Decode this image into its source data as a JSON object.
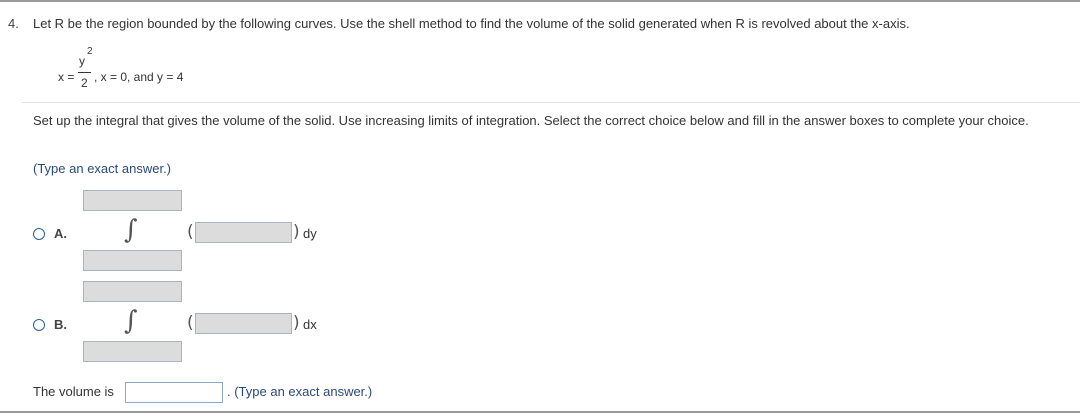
{
  "question": {
    "number": "4.",
    "text": "Let R be the region bounded by the following curves. Use the shell method to find the volume of the solid generated when R is revolved about the x-axis.",
    "equation": {
      "lhs": "x =",
      "numerator": "y",
      "exponent": "2",
      "denominator": "2",
      "rest": ", x = 0, and y = 4"
    }
  },
  "instructions": "Set up the integral that gives the volume of the solid. Use increasing limits of integration. Select the correct choice below and fill in the answer boxes to complete your choice.",
  "hint": "(Type an exact answer.)",
  "choices": [
    {
      "letter": "A.",
      "integral_symbol": "∫",
      "open_paren": "(",
      "close_paren": ")",
      "differential": "dy"
    },
    {
      "letter": "B.",
      "integral_symbol": "∫",
      "open_paren": "(",
      "close_paren": ")",
      "differential": "dx"
    }
  ],
  "volume": {
    "label": "The volume is",
    "hint": ". (Type an exact answer.)"
  },
  "colors": {
    "radio_border": "#2a5f9e",
    "hint_text": "#2a4a7a",
    "answer_box_fill": "#dcdcdc"
  }
}
